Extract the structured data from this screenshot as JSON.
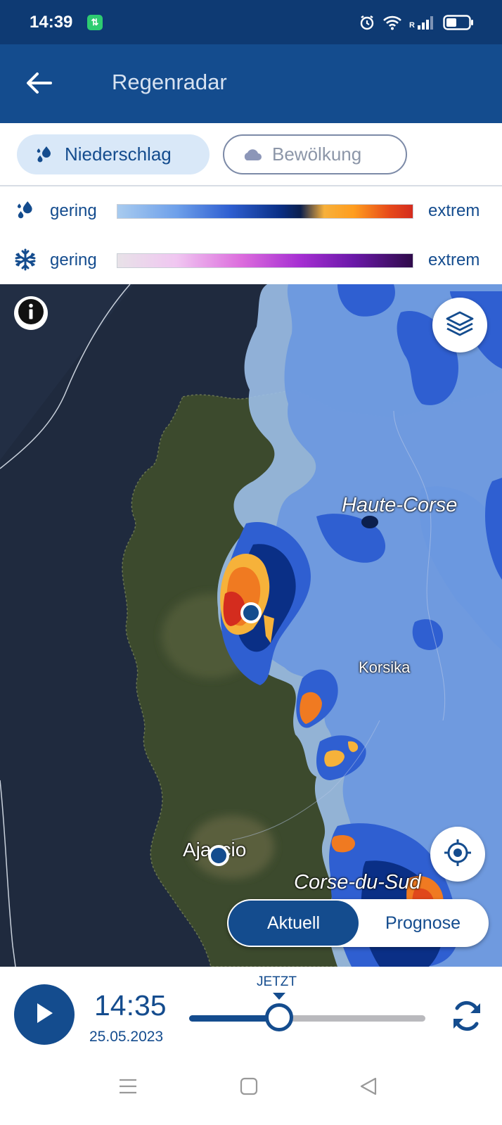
{
  "status_bar": {
    "time": "14:39",
    "app_icon_glyph": "⇅",
    "network_label": "R",
    "icons": [
      "alarm-icon",
      "wifi-icon",
      "signal-icon",
      "battery-icon"
    ],
    "battery_level": 0.45
  },
  "header": {
    "title": "Regenradar",
    "back_icon": "arrow-left-icon"
  },
  "layer_tabs": [
    {
      "label": "Niederschlag",
      "icon": "raindrops-icon",
      "active": true
    },
    {
      "label": "Bewölkung",
      "icon": "cloud-icon",
      "active": false
    }
  ],
  "legend": {
    "rain": {
      "icon": "raindrops-icon",
      "low": "gering",
      "high": "extrem"
    },
    "snow": {
      "icon": "snowflake-icon",
      "low": "gering",
      "high": "extrem"
    }
  },
  "map": {
    "labels": {
      "haute_corse": "Haute-Corse",
      "korsika": "Korsika",
      "ajaccio": "Ajaccio",
      "corse_du_sud": "Corse-du-Sud"
    },
    "buttons": {
      "info": "info-icon",
      "layers": "layers-icon",
      "locate": "crosshair-icon"
    },
    "mode_toggle": {
      "options": [
        "Aktuell",
        "Prognose"
      ],
      "selected": "Aktuell"
    }
  },
  "player": {
    "time": "14:35",
    "date": "25.05.2023",
    "now_label": "JETZT",
    "progress": 0.38,
    "play_icon": "play-icon",
    "refresh_icon": "refresh-icon"
  },
  "colors": {
    "primary": "#144c8e",
    "status_bar": "#0e3a73",
    "tab_active_bg": "#d9e8f8"
  },
  "system_nav": [
    "menu-icon",
    "home-square-icon",
    "back-triangle-icon"
  ]
}
